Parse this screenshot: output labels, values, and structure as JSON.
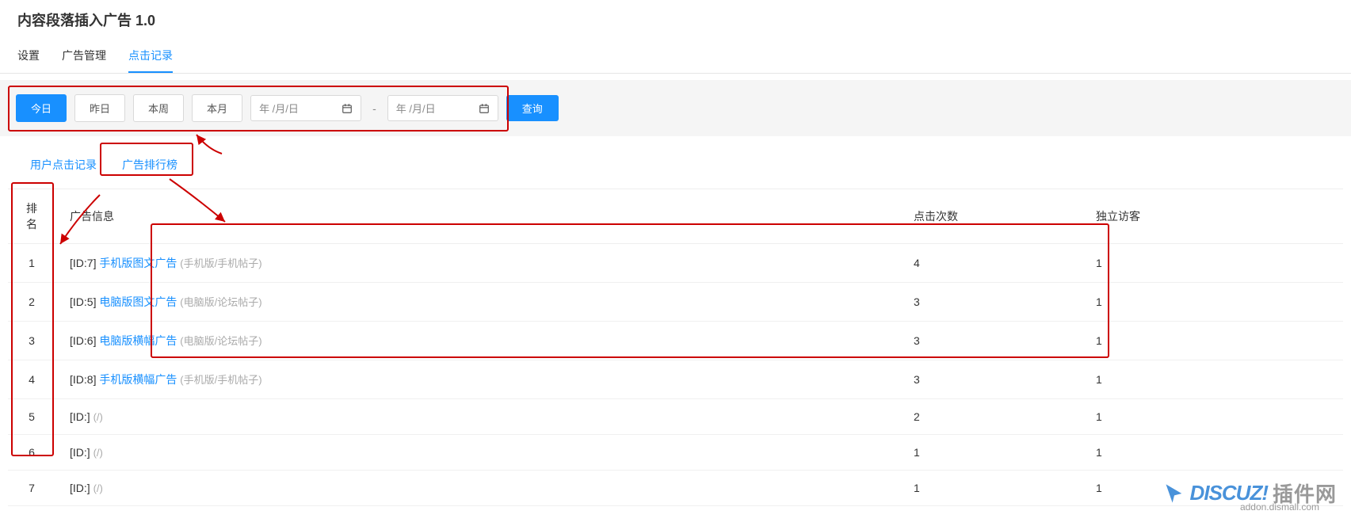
{
  "page_title": "内容段落插入广告 1.0",
  "main_tabs": {
    "settings": "设置",
    "ad_manage": "广告管理",
    "click_log": "点击记录"
  },
  "filter": {
    "today": "今日",
    "yesterday": "昨日",
    "this_week": "本周",
    "this_month": "本月",
    "date_placeholder": "年 /月/日",
    "sep": "-",
    "query": "查询"
  },
  "sub_tabs": {
    "user_click_log": "用户点击记录",
    "ad_ranking": "广告排行榜"
  },
  "table": {
    "headers": {
      "rank": "排名",
      "info": "广告信息",
      "clicks": "点击次数",
      "visitors": "独立访客"
    },
    "rows": [
      {
        "rank": "1",
        "id": "[ID:7]",
        "name": "手机版图文广告",
        "meta": "(手机版/手机帖子)",
        "clicks": "4",
        "visitors": "1"
      },
      {
        "rank": "2",
        "id": "[ID:5]",
        "name": "电脑版图文广告",
        "meta": "(电脑版/论坛帖子)",
        "clicks": "3",
        "visitors": "1"
      },
      {
        "rank": "3",
        "id": "[ID:6]",
        "name": "电脑版横幅广告",
        "meta": "(电脑版/论坛帖子)",
        "clicks": "3",
        "visitors": "1"
      },
      {
        "rank": "4",
        "id": "[ID:8]",
        "name": "手机版横幅广告",
        "meta": "(手机版/手机帖子)",
        "clicks": "3",
        "visitors": "1"
      },
      {
        "rank": "5",
        "id": "[ID:]",
        "name": "",
        "meta": "(/)",
        "clicks": "2",
        "visitors": "1"
      },
      {
        "rank": "6",
        "id": "[ID:]",
        "name": "",
        "meta": "(/)",
        "clicks": "1",
        "visitors": "1"
      },
      {
        "rank": "7",
        "id": "[ID:]",
        "name": "",
        "meta": "(/)",
        "clicks": "1",
        "visitors": "1"
      }
    ]
  },
  "watermark": {
    "brand1": "DISCUZ!",
    "brand2": "插件网",
    "sub": "addon.dismall.com"
  }
}
